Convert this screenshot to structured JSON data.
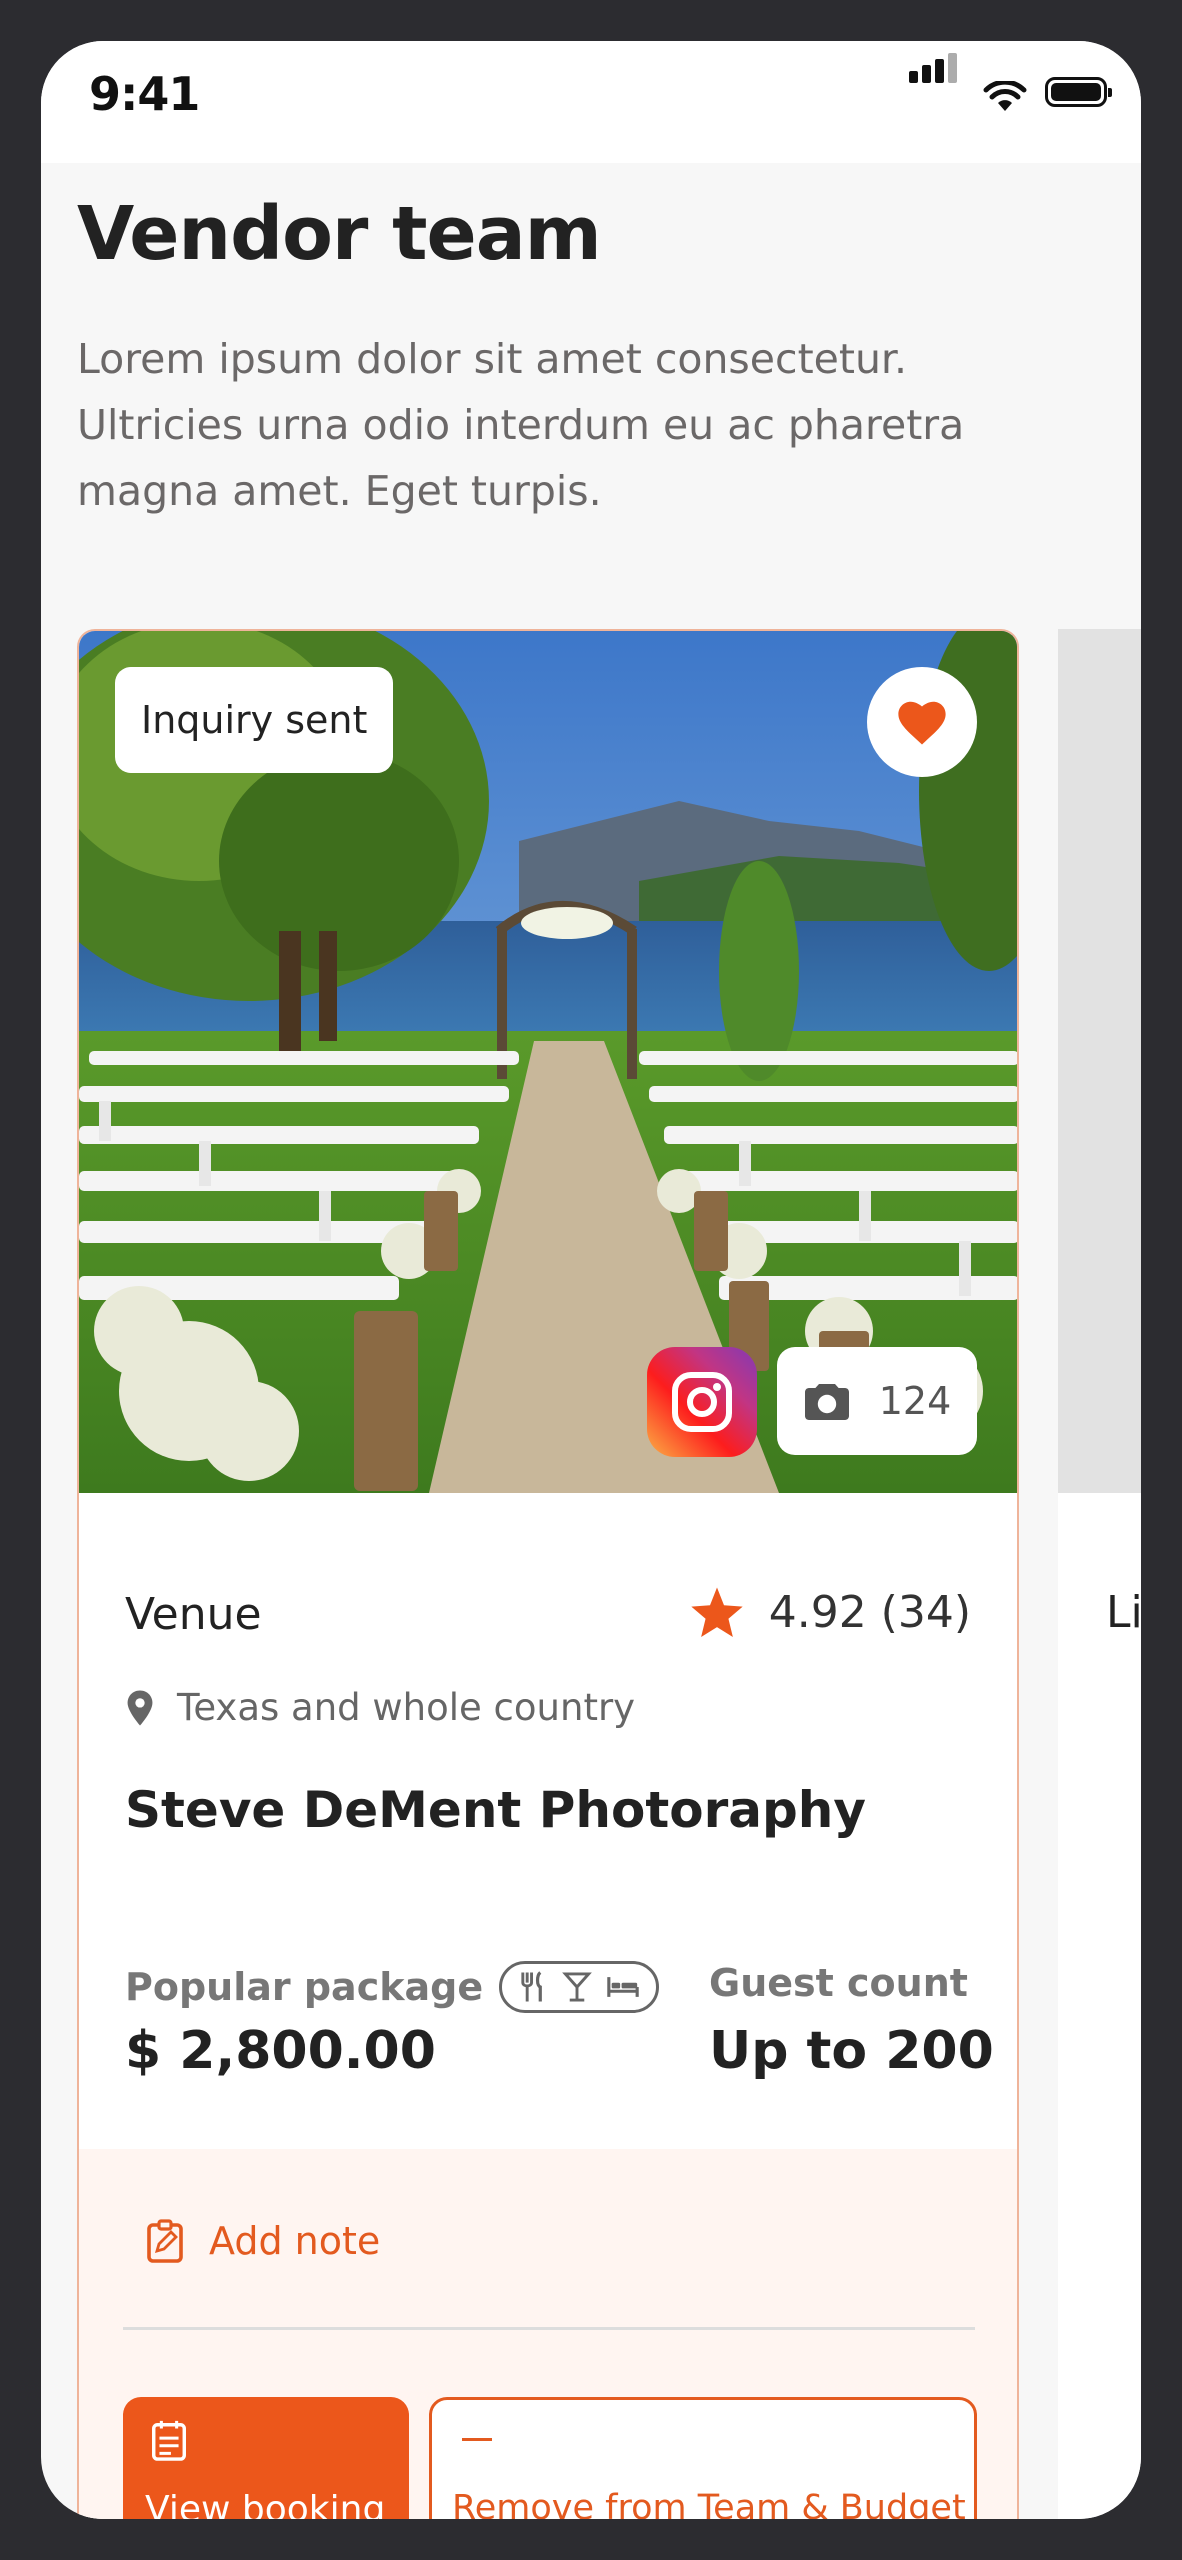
{
  "status_bar": {
    "time": "9:41"
  },
  "page": {
    "title": "Vendor team",
    "description": "Lorem ipsum dolor sit amet consectetur. Ultricies urna odio interdum eu ac pharetra magna amet. Eget turpis."
  },
  "card": {
    "badge": "Inquiry sent",
    "favorite": true,
    "photo_count": "124",
    "category": "Venue",
    "rating": "4.92 (34)",
    "location": "Texas and whole country",
    "name": "Steve DeMent Photoraphy",
    "package_label": "Popular package",
    "package_icons": [
      "fork-knife-icon",
      "cocktail-icon",
      "bed-icon"
    ],
    "price": "$ 2,800.00",
    "guest_label": "Guest count",
    "guest_value": "Up to 200",
    "add_note": "Add note",
    "view_booking": "View booking",
    "remove": "Remove from Team & Budget"
  },
  "next_card": {
    "category_partial": "Li"
  },
  "colors": {
    "accent": "#ec571b",
    "card_border": "#efb49a",
    "action_bg": "#fff5f1"
  }
}
